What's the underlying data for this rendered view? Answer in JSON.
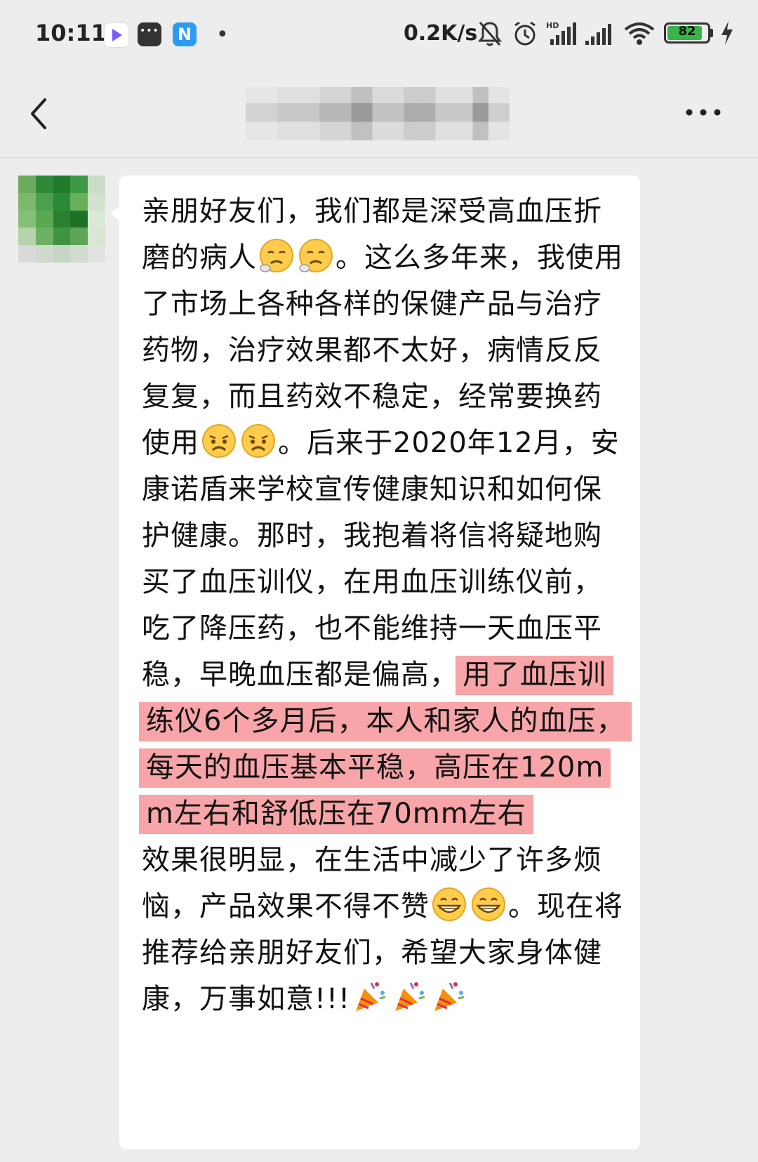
{
  "status_bar": {
    "time": "10:11",
    "network_speed": "0.2K/s",
    "battery_level": "82",
    "icons": [
      "video-app-icon",
      "message-app-icon",
      "n-app-icon",
      "notification-dot",
      "bell-muted-icon",
      "alarm-icon",
      "hd-signal-icon",
      "signal-icon",
      "wifi-icon",
      "battery-icon",
      "charging-bolt-icon"
    ]
  },
  "header": {
    "title": "",
    "back_icon": "chevron-left-icon",
    "more_icon": "more-dots-icon"
  },
  "message": {
    "part1": "亲朋好友们，我们都是深受高血压折磨的病人",
    "emoji1": "sad-face-emoji",
    "part2": "。这么多年来，我使用了市场上各种各样的保健产品与治疗药物，治疗效果都不太好，病情反反复复，而且药效不稳定，经常要换药使用",
    "emoji2": "frowning-face-emoji",
    "part3": "。后来于2020年12月，安康诺盾来学校宣传健康知识和如何保护健康。那时，我抱着将信将疑地购买了血压训仪，在用血压训练仪前，吃了降压药，也不能维持一天血压平稳，早晚血压都是偏高，",
    "highlighted": "用了血压训练仪6个多月后，本人和家人的血压，每天的血压基本平稳，高压在120mm左右和舒低压在70mm左右",
    "part4": "效果很明显，在生活中减少了许多烦恼，产品效果不得不赞",
    "emoji3": "grinning-face-emoji",
    "part5": "。现在将推荐给亲朋好友们，希望大家身体健康，万事如意!!!",
    "emoji4": "party-popper-emoji",
    "highlight_color": "#f7a5a8"
  }
}
